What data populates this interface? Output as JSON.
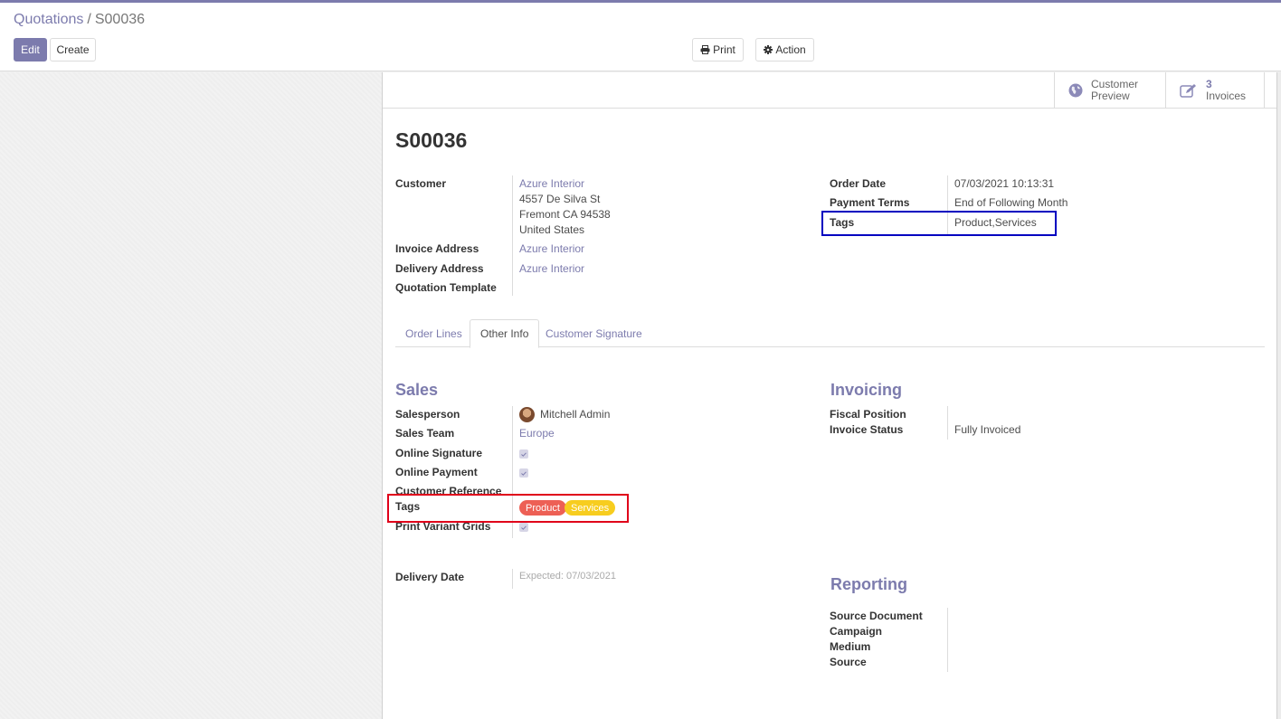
{
  "breadcrumb": {
    "parent": "Quotations",
    "separator": "/",
    "current": "S00036"
  },
  "toolbar": {
    "edit_label": "Edit",
    "create_label": "Create",
    "print_label": "Print",
    "action_label": "Action"
  },
  "smart_buttons": {
    "customer_preview": {
      "line1": "Customer",
      "line2": "Preview",
      "icon": "globe-icon"
    },
    "invoices": {
      "count": "3",
      "label": "Invoices",
      "icon": "edit-icon"
    }
  },
  "record": {
    "title": "S00036",
    "customer": {
      "label": "Customer",
      "name": "Azure Interior",
      "address_line1": "4557 De Silva St",
      "address_line2": "Fremont CA 94538",
      "address_line3": "United States"
    },
    "invoice_address": {
      "label": "Invoice Address",
      "value": "Azure Interior"
    },
    "delivery_address": {
      "label": "Delivery Address",
      "value": "Azure Interior"
    },
    "quotation_template": {
      "label": "Quotation Template",
      "value": ""
    },
    "order_date": {
      "label": "Order Date",
      "value": "07/03/2021 10:13:31"
    },
    "payment_terms": {
      "label": "Payment Terms",
      "value": "End of Following Month"
    },
    "tags": {
      "label": "Tags",
      "value": "Product,Services"
    }
  },
  "tabs": [
    {
      "label": "Order Lines",
      "active": false
    },
    {
      "label": "Other Info",
      "active": true
    },
    {
      "label": "Customer Signature",
      "active": false
    }
  ],
  "other_info": {
    "sales": {
      "title": "Sales",
      "salesperson": {
        "label": "Salesperson",
        "value": "Mitchell Admin"
      },
      "sales_team": {
        "label": "Sales Team",
        "value": "Europe"
      },
      "online_signature": {
        "label": "Online Signature",
        "checked": true
      },
      "online_payment": {
        "label": "Online Payment",
        "checked": true
      },
      "customer_reference": {
        "label": "Customer Reference",
        "value": ""
      },
      "tags": {
        "label": "Tags",
        "values": [
          {
            "name": "Product",
            "color": "#ed6055"
          },
          {
            "name": "Services",
            "color": "#f7cd1f"
          }
        ]
      },
      "print_variant_grids": {
        "label": "Print Variant Grids",
        "checked": true
      }
    },
    "delivery": {
      "delivery_date": {
        "label": "Delivery Date",
        "placeholder": "Expected: 07/03/2021"
      }
    },
    "invoicing": {
      "title": "Invoicing",
      "fiscal_position": {
        "label": "Fiscal Position",
        "value": ""
      },
      "invoice_status": {
        "label": "Invoice Status",
        "value": "Fully Invoiced"
      }
    },
    "reporting": {
      "title": "Reporting",
      "source_document": {
        "label": "Source Document",
        "value": ""
      },
      "campaign": {
        "label": "Campaign",
        "value": ""
      },
      "medium": {
        "label": "Medium",
        "value": ""
      },
      "source": {
        "label": "Source",
        "value": ""
      }
    }
  },
  "colors": {
    "brand": "#7c7bad",
    "highlight_blue": "#0000c0",
    "highlight_red": "#e0001a"
  }
}
